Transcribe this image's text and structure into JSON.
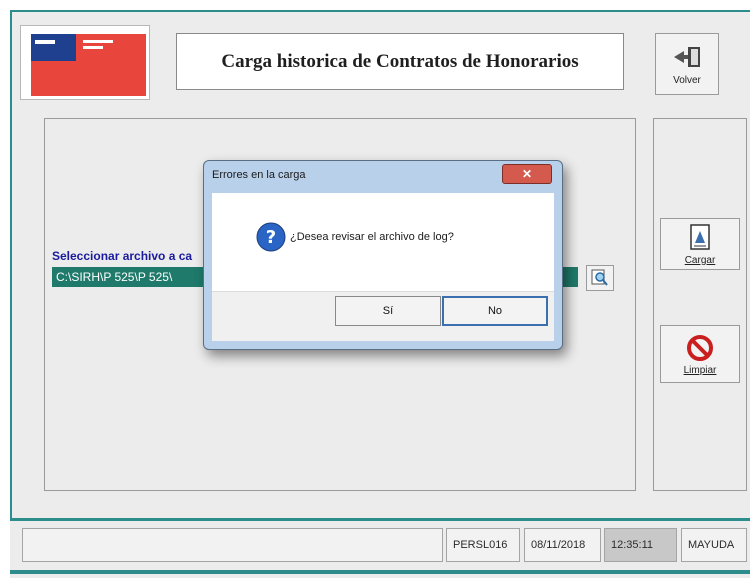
{
  "header": {
    "title": "Carga historica de Contratos de Honorarios"
  },
  "toolbar": {
    "volver_label": "Volver",
    "cargar_label": "Cargar",
    "limpiar_label": "Limpiar"
  },
  "form": {
    "select_label": "Seleccionar archivo a ca",
    "file_path": "C:\\SIRH\\P 525\\P 525\\"
  },
  "dialog": {
    "title": "Errores en la carga",
    "close_label": "✕",
    "message": "¿Desea revisar el archivo de log?",
    "yes_label": "Sí",
    "no_label": "No"
  },
  "statusbar": {
    "user": "PERSL016",
    "date": "08/11/2018",
    "time": "12:35:11",
    "caps": "MAYUDA"
  },
  "colors": {
    "accent": "#2d8c8c",
    "path_field": "#1f7a6b",
    "label_blue": "#1a1a9e"
  }
}
